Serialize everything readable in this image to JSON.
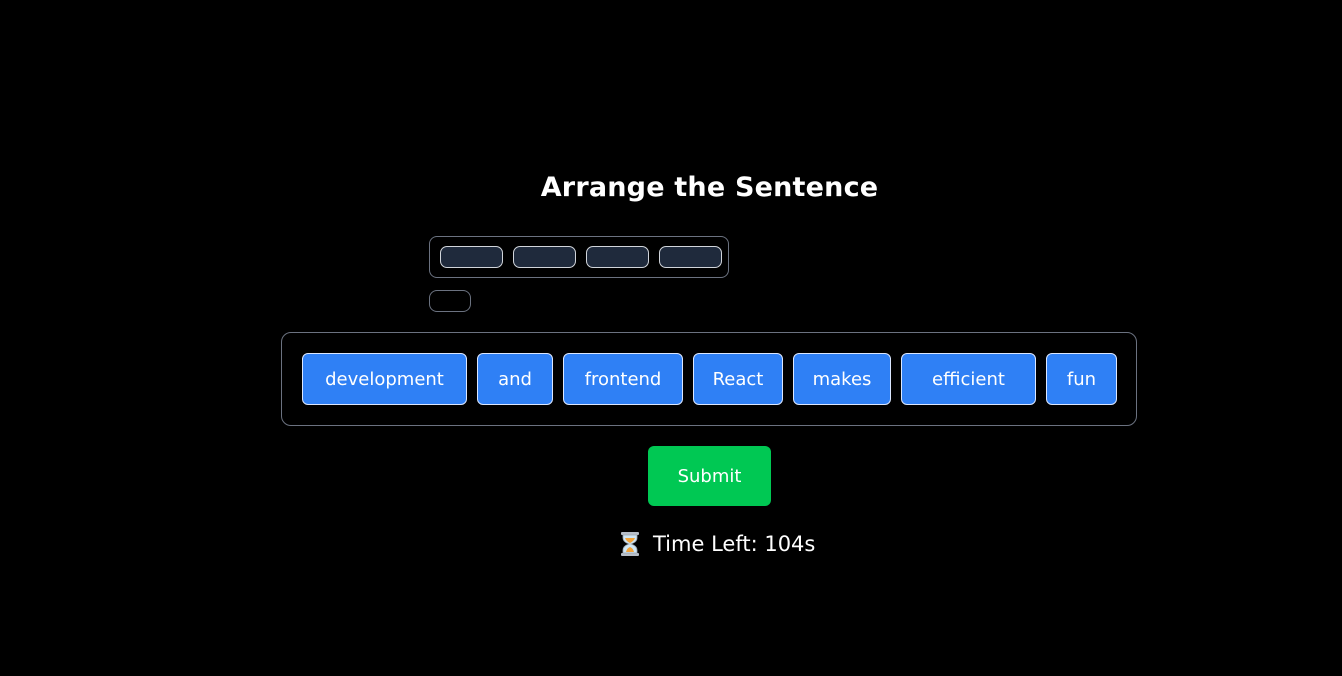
{
  "game": {
    "title": "Arrange the Sentence",
    "answer_slots": 5,
    "word_bank": [
      "development",
      "and",
      "frontend",
      "React",
      "makes",
      "efficient",
      "fun"
    ],
    "submit_label": "Submit",
    "timer_icon": "hourglass-icon",
    "timer_text": "Time Left: 104s"
  },
  "colors": {
    "background": "#000000",
    "word_tile": "#2f80f5",
    "slot": "#1f2a3c",
    "submit": "#00c853"
  }
}
